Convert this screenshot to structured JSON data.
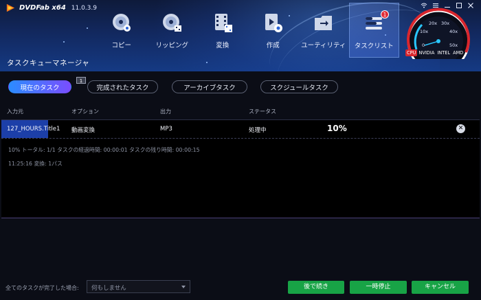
{
  "app": {
    "name": "DVDFab x64",
    "version": "11.0.3.9",
    "window_controls": [
      "wifi-icon",
      "menu-icon",
      "minimize-icon",
      "maximize-icon",
      "close-icon"
    ]
  },
  "nav": {
    "items": [
      {
        "label": "コピー",
        "icon": "disc-copy-icon"
      },
      {
        "label": "リッピング",
        "icon": "disc-rip-icon"
      },
      {
        "label": "変換",
        "icon": "film-convert-icon"
      },
      {
        "label": "作成",
        "icon": "film-create-icon"
      },
      {
        "label": "ユーティリティ",
        "icon": "folder-utility-icon"
      },
      {
        "label": "タスクリスト",
        "icon": "task-list-icon",
        "badge": "1",
        "active": true
      }
    ]
  },
  "gauge": {
    "ticks": [
      "0",
      "10x",
      "20x",
      "30x",
      "40x",
      "50x"
    ],
    "labels": [
      "CPU",
      "NVIDIA",
      "INTEL",
      "AMD"
    ]
  },
  "page_title": "タスクキューマネージャ",
  "tabs": [
    {
      "label": "現在のタスク",
      "count": "1",
      "active": true
    },
    {
      "label": "完成されたタスク"
    },
    {
      "label": "アーカイブタスク"
    },
    {
      "label": "スクジュールタスク"
    }
  ],
  "columns": {
    "source": "入力元",
    "option": "オプション",
    "output": "出力",
    "status": "ステータス"
  },
  "task": {
    "source": "127_HOURS.Title1",
    "option": "動画変換",
    "output": "MP3",
    "status": "処理中",
    "progress": "10%"
  },
  "log": {
    "line1": "10%  トータル: 1/1 タスクの経過時間: 00:00:01 タスクの残り時間: 00:00:15",
    "line2": "11:25:16   変換: 1パス"
  },
  "footer": {
    "label": "全てのタスクが完了した場合:",
    "select_value": "何もしません",
    "buttons": {
      "continue": "後で続き",
      "pause": "一時停止",
      "cancel": "キャンセル"
    }
  },
  "colors": {
    "accent": "#2b8cff",
    "tab_gradient_end": "#7a4dff",
    "button_green": "#18a346",
    "selection_blue": "#1c3fa8",
    "badge_red": "#e12b35"
  }
}
